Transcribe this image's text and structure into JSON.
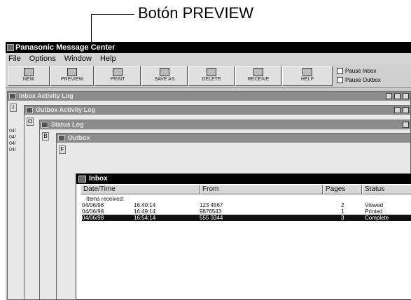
{
  "callout": {
    "label": "Botón PREVIEW"
  },
  "app": {
    "title": "Panasonic Message Center"
  },
  "menu": [
    "File",
    "Options",
    "Window",
    "Help"
  ],
  "toolbar": {
    "buttons": [
      "NEW",
      "PREVIEW",
      "PRINT",
      "SAVE AS",
      "DELETE",
      "RECEIVE",
      "HELP"
    ],
    "checkboxes": [
      "Pause Inbox",
      "Pause Outbox"
    ]
  },
  "windows": {
    "inbox_activity": "Inbox Activity Log",
    "outbox_activity": "Outbox Activity Log",
    "status_log": "Status Log",
    "outbox": "Outbox"
  },
  "side_dates": [
    "04/",
    "04/",
    "04/",
    "04/"
  ],
  "inbox": {
    "title": "Inbox",
    "columns": [
      "Date/Time",
      "From",
      "Pages",
      "Status"
    ],
    "group_label": "Items received:",
    "rows": [
      {
        "date": "04/06/98",
        "time": "16:40:14",
        "from": "123 4567",
        "pages": "2",
        "status": "Viewed"
      },
      {
        "date": "04/06/98",
        "time": "16:49:14",
        "from": "9876543",
        "pages": "1",
        "status": "Printed"
      },
      {
        "date": "04/06/98",
        "time": "16:54:14",
        "from": "555 3344",
        "pages": "3",
        "status": "Complete"
      }
    ]
  }
}
